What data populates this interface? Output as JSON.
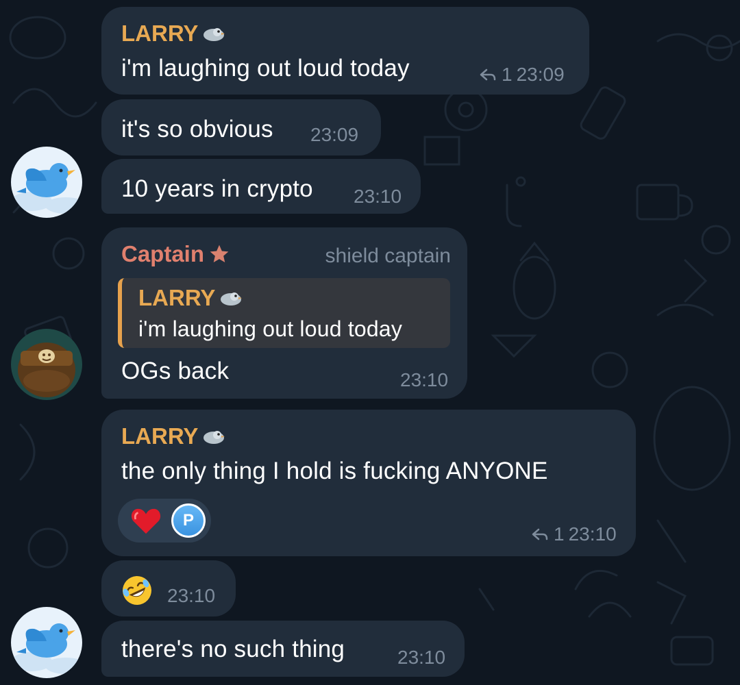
{
  "colors": {
    "background": "#0f1721",
    "bubble": "#212d3b",
    "larry_name": "#e8a953",
    "captain_name": "#e0806e",
    "timestamp": "#7e8c9c",
    "quote_bg": "#34373d",
    "quote_bar": "#e7a24d"
  },
  "messages": [
    {
      "sender": "LARRY",
      "sender_emoji": "pigeon-emoji",
      "text": "i'm laughing out loud today",
      "replies": "1",
      "time": "23:09"
    },
    {
      "text": "it's so obvious",
      "time": "23:09"
    },
    {
      "text": "10 years in crypto",
      "time": "23:10",
      "avatar": "bird-avatar"
    },
    {
      "sender": "Captain",
      "sender_emoji": "star-icon",
      "title": "shield captain",
      "quote": {
        "sender": "LARRY",
        "text": "i'm laughing out loud today"
      },
      "text": "OGs back",
      "time": "23:10",
      "avatar": "ape-avatar"
    },
    {
      "sender": "LARRY",
      "sender_emoji": "pigeon-emoji",
      "text": "the only thing I hold is fucking ANYONE",
      "reaction": {
        "emoji": "red-heart-emoji",
        "user_initial": "P"
      },
      "replies": "1",
      "time": "23:10"
    },
    {
      "emoji": "rolling-on-floor-laughing-emoji",
      "time": "23:10"
    },
    {
      "text": "there's no such thing",
      "time": "23:10",
      "avatar": "bird-avatar"
    }
  ]
}
